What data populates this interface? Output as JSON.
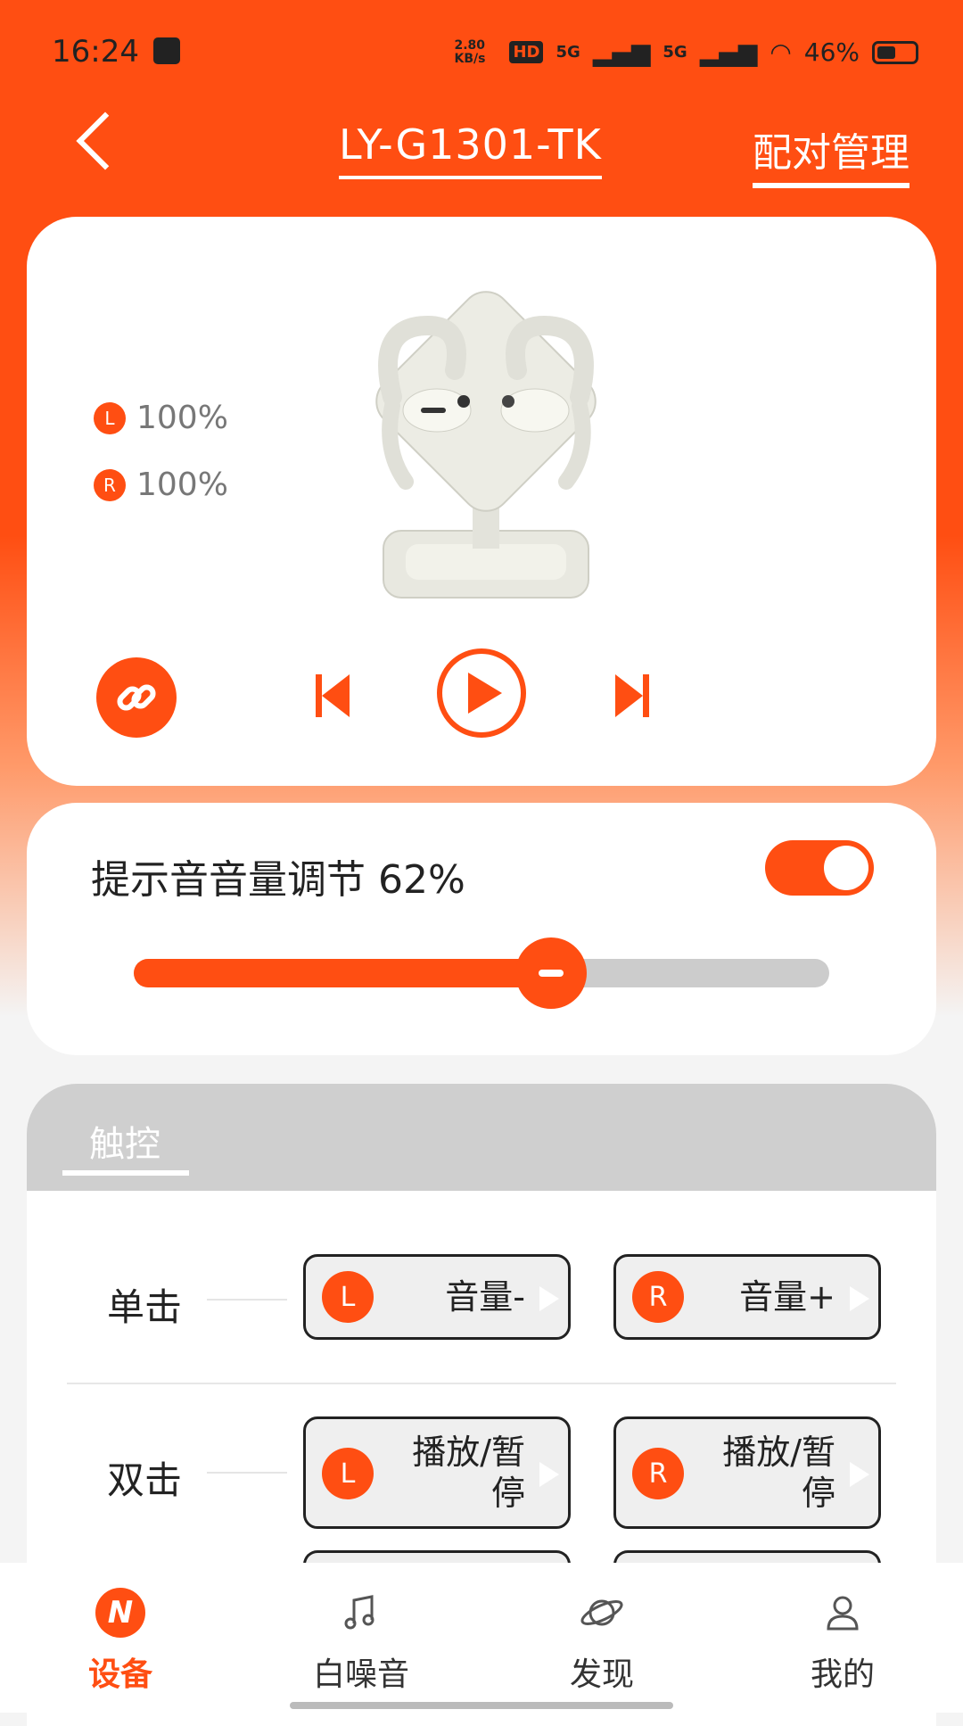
{
  "status_bar": {
    "time": "16:24",
    "net_speed": "2.80 KB/s",
    "hd": "HD",
    "sig1": "5G",
    "sig2": "5G",
    "battery": "46%"
  },
  "header": {
    "title": "LY-G1301-TK",
    "pair_manage": "配对管理"
  },
  "battery": {
    "left_label": "L",
    "left_value": "100%",
    "right_label": "R",
    "right_value": "100%"
  },
  "tone": {
    "label": "提示音音量调节 62%",
    "volume_percent": 62,
    "enabled": true
  },
  "touch": {
    "tab_label": "触控",
    "rows": [
      {
        "label": "单击",
        "left": {
          "side": "L",
          "action": "音量-"
        },
        "right": {
          "side": "R",
          "action": "音量+"
        }
      },
      {
        "label": "双击",
        "left": {
          "side": "L",
          "action_line1": "播放/暂",
          "action_line2": "停"
        },
        "right": {
          "side": "R",
          "action_line1": "播放/暂",
          "action_line2": "停"
        }
      }
    ]
  },
  "nav": {
    "items": [
      {
        "label": "设备",
        "icon": "n-logo-icon",
        "active": true
      },
      {
        "label": "白噪音",
        "icon": "music-note-icon"
      },
      {
        "label": "发现",
        "icon": "planet-icon"
      },
      {
        "label": "我的",
        "icon": "person-icon"
      }
    ]
  },
  "colors": {
    "accent": "#ff4e12",
    "track": "#cccccc"
  }
}
